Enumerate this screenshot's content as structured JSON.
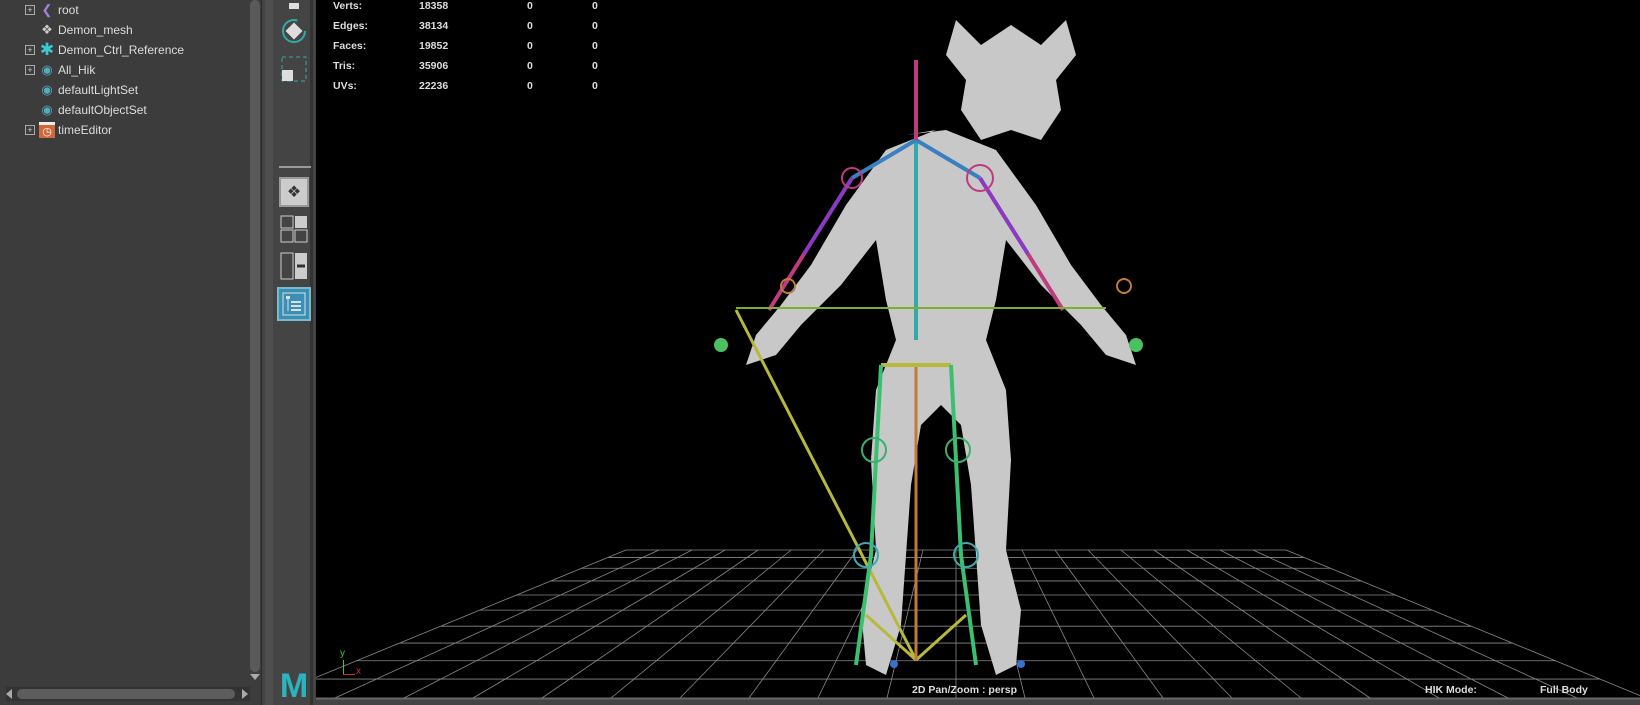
{
  "outliner": {
    "items": [
      {
        "label": "root",
        "icon": "joint-icon",
        "expandable": true
      },
      {
        "label": "Demon_mesh",
        "icon": "mesh-icon",
        "expandable": false
      },
      {
        "label": "Demon_Ctrl_Reference",
        "icon": "locator-icon",
        "expandable": true
      },
      {
        "label": "All_Hik",
        "icon": "set-icon",
        "expandable": true
      },
      {
        "label": "defaultLightSet",
        "icon": "set-icon",
        "expandable": false
      },
      {
        "label": "defaultObjectSet",
        "icon": "set-icon",
        "expandable": false
      },
      {
        "label": "timeEditor",
        "icon": "time-editor-icon",
        "expandable": true
      }
    ]
  },
  "stats": [
    {
      "label": "Verts:",
      "v1": "18358",
      "v2": "0",
      "v3": "0"
    },
    {
      "label": "Edges:",
      "v1": "38134",
      "v2": "0",
      "v3": "0"
    },
    {
      "label": "Faces:",
      "v1": "19852",
      "v2": "0",
      "v3": "0"
    },
    {
      "label": "Tris:",
      "v1": "35906",
      "v2": "0",
      "v3": "0"
    },
    {
      "label": "UVs:",
      "v1": "22236",
      "v2": "0",
      "v3": "0"
    }
  ],
  "viewport": {
    "camera_label": "2D Pan/Zoom : persp",
    "hik_mode_label": "HIK Mode:",
    "hik_mode_value": "Full Body",
    "axis_y": "y",
    "axis_x": "x"
  },
  "colors": {
    "accent": "#3a8fb7",
    "maya_logo": "#2bb3c0"
  }
}
